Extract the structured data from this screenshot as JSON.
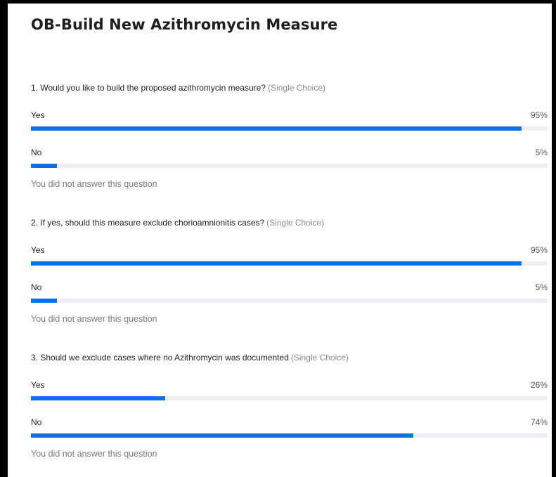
{
  "poll": {
    "title": "OB-Build New Azithromycin Measure",
    "questions": [
      {
        "text": "1. Would you like to build the proposed azithromycin measure?",
        "type": "(Single Choice)",
        "options": [
          {
            "label": "Yes",
            "percent_text": "95%",
            "percent": 95
          },
          {
            "label": "No",
            "percent_text": "5%",
            "percent": 5
          }
        ],
        "note": "You did not answer this question"
      },
      {
        "text": "2. If yes, should this measure exclude chorioamnionitis cases?",
        "type": "(Single Choice)",
        "options": [
          {
            "label": "Yes",
            "percent_text": "95%",
            "percent": 95
          },
          {
            "label": "No",
            "percent_text": "5%",
            "percent": 5
          }
        ],
        "note": "You did not answer this question"
      },
      {
        "text": "3. Should we exclude cases where no Azithromycin was documented",
        "type": "(Single Choice)",
        "options": [
          {
            "label": "Yes",
            "percent_text": "26%",
            "percent": 26
          },
          {
            "label": "No",
            "percent_text": "74%",
            "percent": 74
          }
        ],
        "note": "You did not answer this question"
      }
    ]
  },
  "colors": {
    "bar_fill": "#0e71eb",
    "bar_track": "#eeeff3",
    "frame": "#000000"
  }
}
